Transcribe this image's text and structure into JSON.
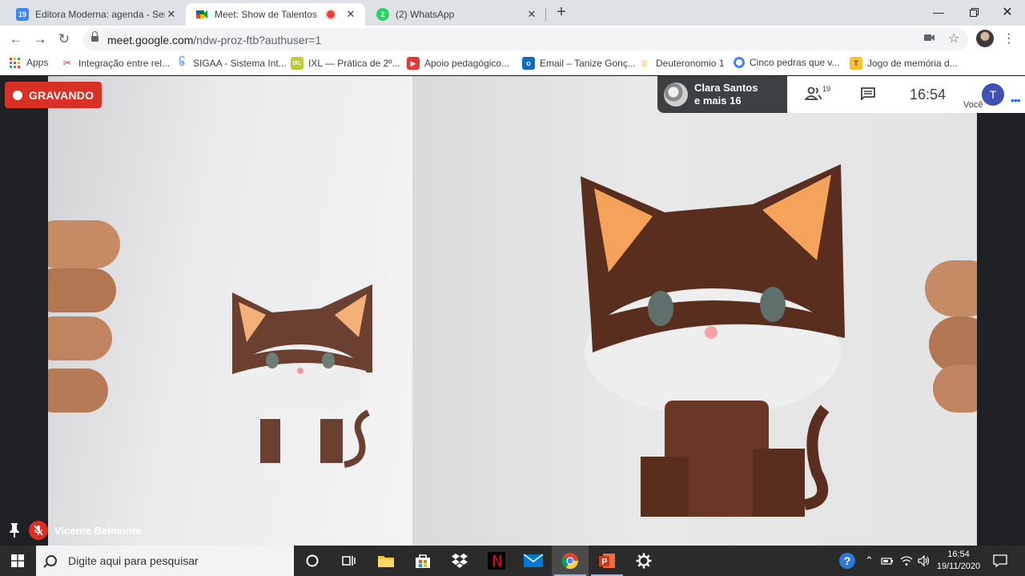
{
  "browser": {
    "tabs": [
      {
        "title": "Editora Moderna: agenda - Sema",
        "favicon": "calendar-icon",
        "favicon_label": "19",
        "color": "#4285f4"
      },
      {
        "title": "Meet: Show de Talentos",
        "favicon": "meet-icon",
        "color": "#00897b",
        "recording": true
      },
      {
        "title": "(2) WhatsApp",
        "favicon": "whatsapp-icon",
        "favicon_label": "2",
        "color": "#25d366"
      }
    ],
    "new_tab": "+",
    "url_host": "meet.google.com",
    "url_path": "/ndw-proz-ftb?authuser=1"
  },
  "bookmarks": [
    {
      "label": "Apps",
      "icon": "apps-grid-icon"
    },
    {
      "label": "Integração entre rel...",
      "icon": "scissors-icon",
      "color": "#e53935"
    },
    {
      "label": "SIGAA - Sistema Int...",
      "icon": "swirl-icon",
      "color": "#5e97f6"
    },
    {
      "label": "IXL — Prática de 2º...",
      "icon": "ixl-icon",
      "color": "#c0ca33"
    },
    {
      "label": "Apoio pedagógico...",
      "icon": "youtube-icon",
      "color": "#e53935"
    },
    {
      "label": "Email – Tanize Gonç...",
      "icon": "outlook-icon",
      "color": "#0f6cbd"
    },
    {
      "label": "Deuteronomio 1",
      "icon": "bible-icon",
      "color": "#f9a825"
    },
    {
      "label": "Cinco pedras que v...",
      "icon": "circle-icon",
      "color": "#4285f4"
    },
    {
      "label": "Jogo de memória d...",
      "icon": "game-icon",
      "color": "#fbc02d"
    }
  ],
  "meet": {
    "recording_label": "GRAVANDO",
    "presenter_name": "Clara Santos",
    "presenter_more": "e mais 16",
    "participants_count": "19",
    "clock": "16:54",
    "self_initial": "T",
    "self_label": "Você",
    "speaker_name": "Vicente Belmonte"
  },
  "taskbar": {
    "search_placeholder": "Digite aqui para pesquisar",
    "time": "16:54",
    "date": "19/11/2020"
  }
}
